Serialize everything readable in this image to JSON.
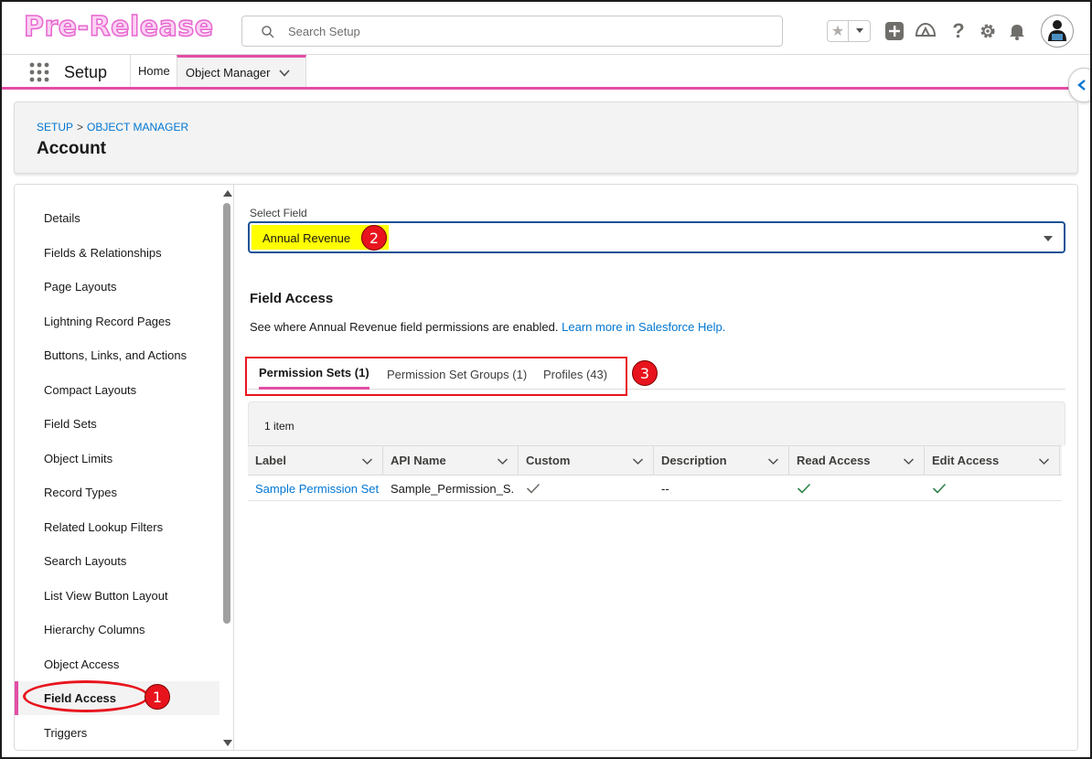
{
  "brand": {
    "text": "Pre-Release"
  },
  "search": {
    "placeholder": "Search Setup"
  },
  "header_icons": [
    "star-icon",
    "chevron-down-icon",
    "add-icon",
    "trailhead-icon",
    "help-icon",
    "gear-icon",
    "bell-icon",
    "avatar"
  ],
  "context": {
    "app_name": "Setup",
    "tabs": [
      {
        "label": "Home"
      },
      {
        "label": "Object Manager"
      }
    ]
  },
  "breadcrumb": {
    "items": [
      "SETUP",
      "OBJECT MANAGER"
    ],
    "separator": ">"
  },
  "page": {
    "title": "Account"
  },
  "left_nav": {
    "items": [
      {
        "label": "Details"
      },
      {
        "label": "Fields & Relationships"
      },
      {
        "label": "Page Layouts"
      },
      {
        "label": "Lightning Record Pages"
      },
      {
        "label": "Buttons, Links, and Actions"
      },
      {
        "label": "Compact Layouts"
      },
      {
        "label": "Field Sets"
      },
      {
        "label": "Object Limits"
      },
      {
        "label": "Record Types"
      },
      {
        "label": "Related Lookup Filters"
      },
      {
        "label": "Search Layouts"
      },
      {
        "label": "List View Button Layout"
      },
      {
        "label": "Hierarchy Columns"
      },
      {
        "label": "Object Access"
      },
      {
        "label": "Field Access"
      },
      {
        "label": "Triggers"
      }
    ],
    "active": "Field Access"
  },
  "field_select": {
    "label": "Select Field",
    "value": "Annual Revenue"
  },
  "field_access": {
    "title": "Field Access",
    "description": "See where Annual Revenue field permissions are enabled.",
    "help_link": "Learn more in Salesforce Help.",
    "tabs": [
      {
        "label": "Permission Sets (1)"
      },
      {
        "label": "Permission Set Groups (1)"
      },
      {
        "label": "Profiles (43)"
      }
    ]
  },
  "table": {
    "item_count": "1 item",
    "columns": [
      "Label",
      "API Name",
      "Custom",
      "Description",
      "Read Access",
      "Edit Access"
    ],
    "rows": [
      {
        "label": "Sample Permission Set",
        "api_name": "Sample_Permission_S...",
        "custom": true,
        "description": "--",
        "read_access": true,
        "edit_access": true
      }
    ]
  },
  "annotations": {
    "badge_1": "1",
    "badge_2": "2",
    "badge_3": "3"
  },
  "colors": {
    "accent_pink": "#e24ea6",
    "link_blue": "#0176d3",
    "annotation_red": "#e8141d",
    "highlight_yellow": "#ffff00",
    "check_green": "#2e844a"
  }
}
